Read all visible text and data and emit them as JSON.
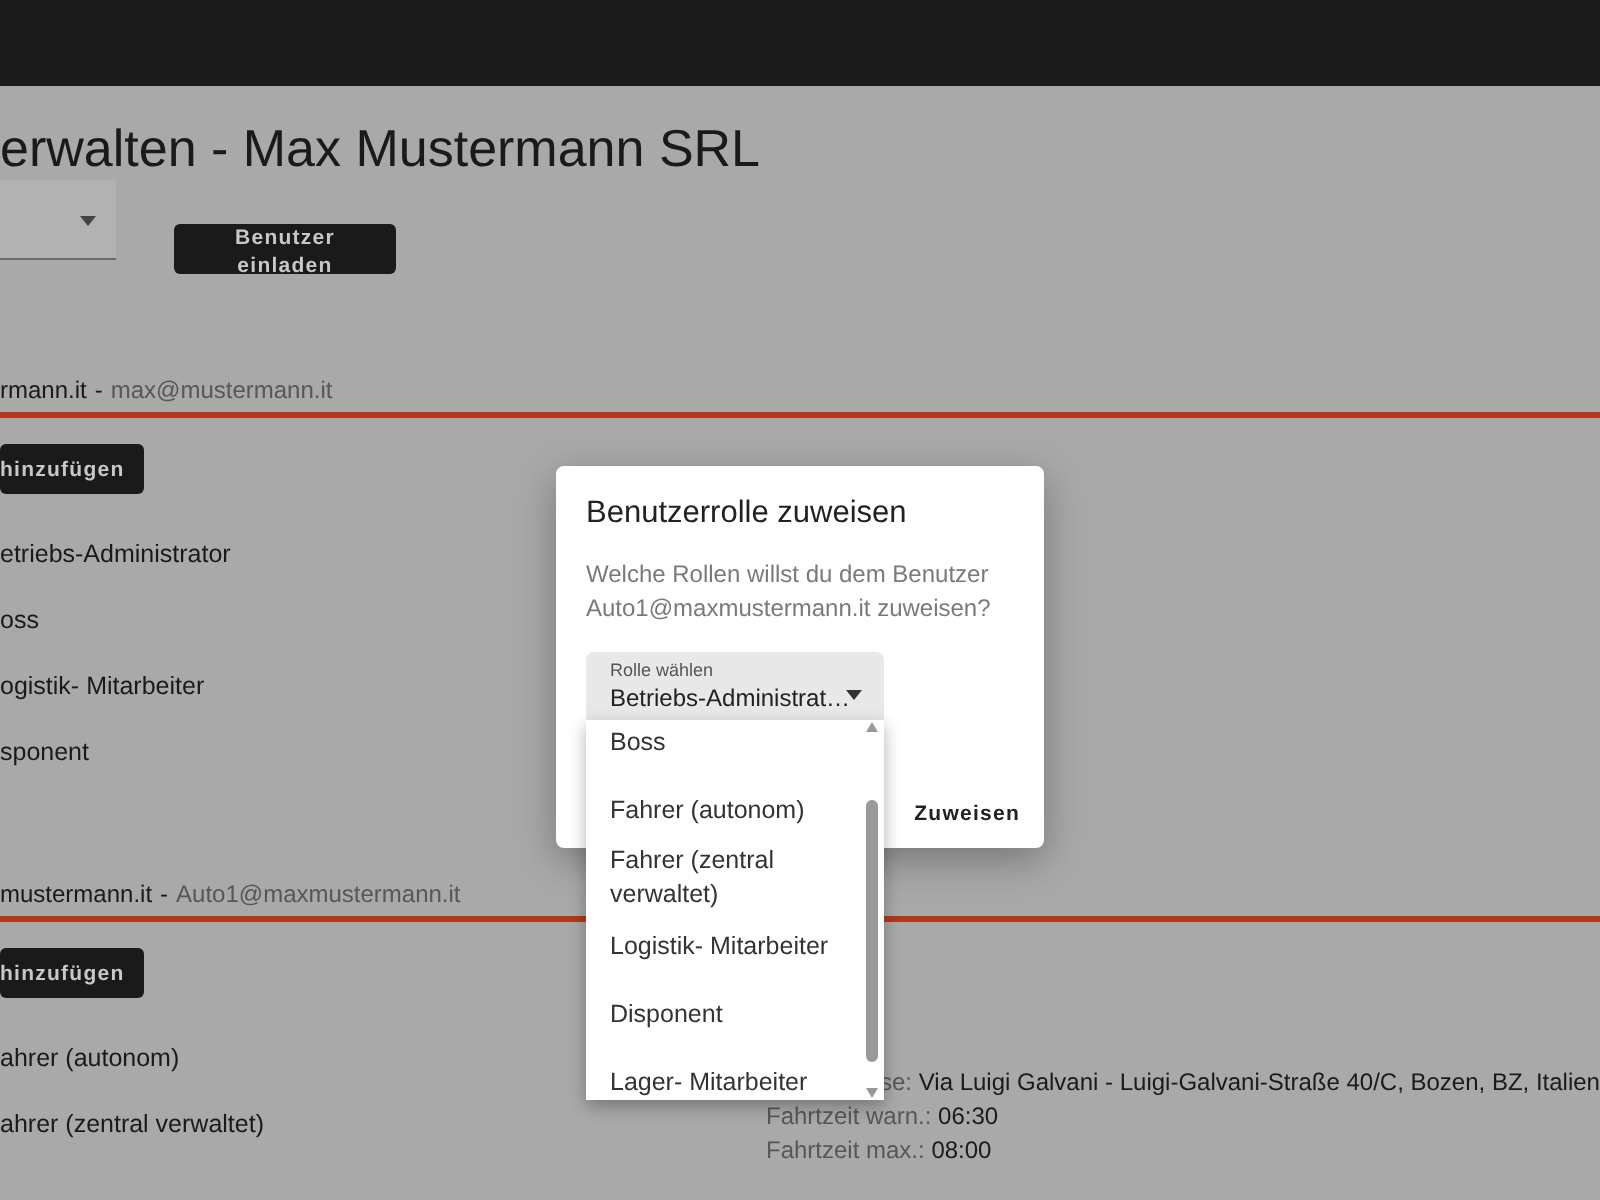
{
  "page": {
    "title": "erwalten - Max Mustermann SRL",
    "invite_button": "Benutzer einladen"
  },
  "users": [
    {
      "name": "rmann.it",
      "separator": "-",
      "email": "max@mustermann.it",
      "add_button": "hinzufügen",
      "roles": [
        "etriebs-Administrator",
        "oss",
        "ogistik- Mitarbeiter",
        "sponent"
      ]
    },
    {
      "name": "mustermann.it",
      "separator": "-",
      "email": "Auto1@maxmustermann.it",
      "add_button": "hinzufügen",
      "roles": [
        "ahrer (autonom)",
        "ahrer (zentral verwaltet)"
      ],
      "details": [
        {
          "label": "se:",
          "value": "Via Luigi Galvani - Luigi-Galvani-Straße 40/C, Bozen, BZ, Italien"
        },
        {
          "label": "Fahrtzeit warn.:",
          "value": "06:30"
        },
        {
          "label": "Fahrtzeit max.:",
          "value": "08:00"
        }
      ]
    }
  ],
  "dialog": {
    "title": "Benutzerrolle zuweisen",
    "message": "Welche Rollen willst du dem Benutzer Auto1@maxmustermann.it zuweisen?",
    "select": {
      "label": "Rolle wählen",
      "value": "Betriebs-Administrat…"
    },
    "buttons": [
      "Zuweisen"
    ]
  },
  "dropdown": {
    "options": [
      "Boss",
      "Fahrer (autonom)",
      "Fahrer (zentral verwaltet)",
      "Logistik- Mitarbeiter",
      "Disponent",
      "Lager- Mitarbeiter"
    ]
  }
}
